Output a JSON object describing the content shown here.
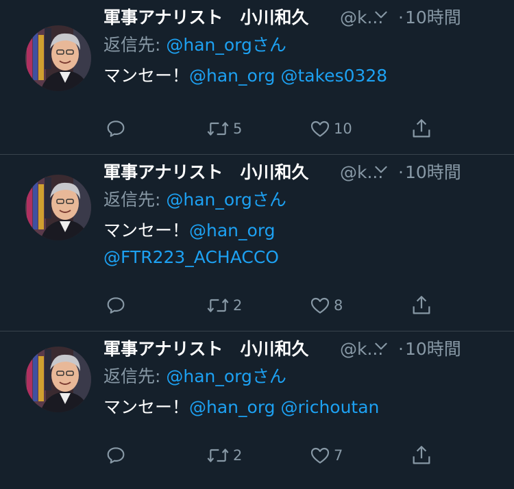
{
  "tweets": [
    {
      "name": "軍事アナリスト　小川和久",
      "handle": "@k...",
      "dot": "·",
      "time": "10時間",
      "reply_prefix": "返信先: ",
      "reply_to": "@han_org",
      "reply_suffix": "さん",
      "text_plain": "マンセー！",
      "mentions_line1": "@han_org @takes0328",
      "mentions_line2": "",
      "retweets": "5",
      "likes": "10"
    },
    {
      "name": "軍事アナリスト　小川和久",
      "handle": "@k...",
      "dot": "·",
      "time": "10時間",
      "reply_prefix": "返信先: ",
      "reply_to": "@han_org",
      "reply_suffix": "さん",
      "text_plain": "マンセー！",
      "mentions_line1": "@han_org",
      "mentions_line2": "@FTR223_ACHACCO",
      "retweets": "2",
      "likes": "8"
    },
    {
      "name": "軍事アナリスト　小川和久",
      "handle": "@k...",
      "dot": "·",
      "time": "10時間",
      "reply_prefix": "返信先: ",
      "reply_to": "@han_org",
      "reply_suffix": "さん",
      "text_plain": "マンセー！",
      "mentions_line1": "@han_org @richoutan",
      "mentions_line2": "",
      "retweets": "2",
      "likes": "7"
    }
  ],
  "icons": {
    "reply": "reply-icon",
    "retweet": "retweet-icon",
    "like": "heart-icon",
    "share": "share-icon",
    "caret": "chevron-down-icon"
  },
  "colors": {
    "background": "#15202b",
    "divider": "#38444d",
    "secondary_text": "#8899a6",
    "accent": "#1da1f2"
  }
}
